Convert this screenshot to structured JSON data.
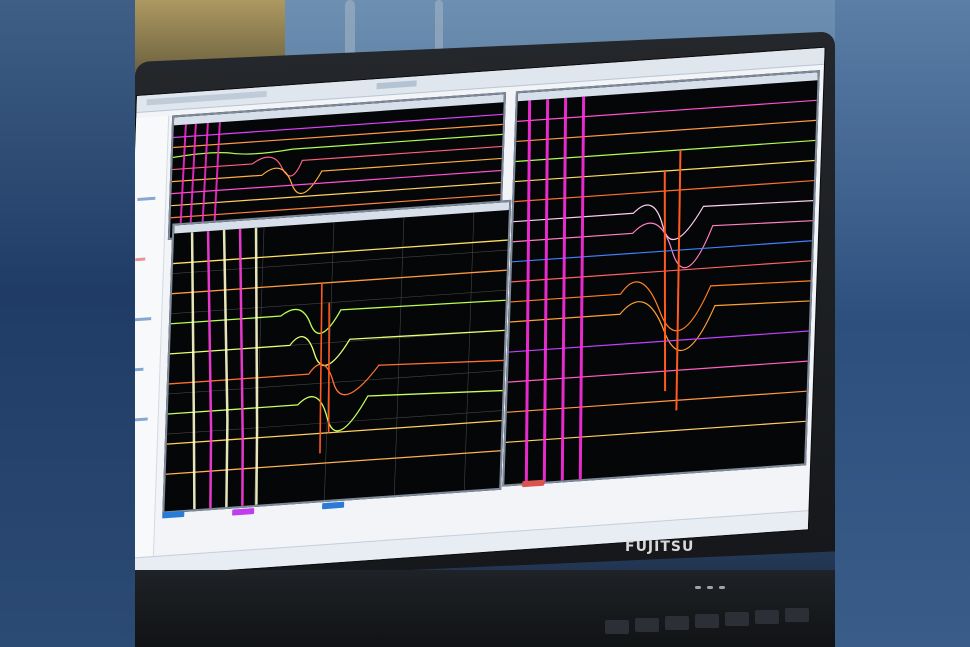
{
  "brand": "FUJITSU"
}
